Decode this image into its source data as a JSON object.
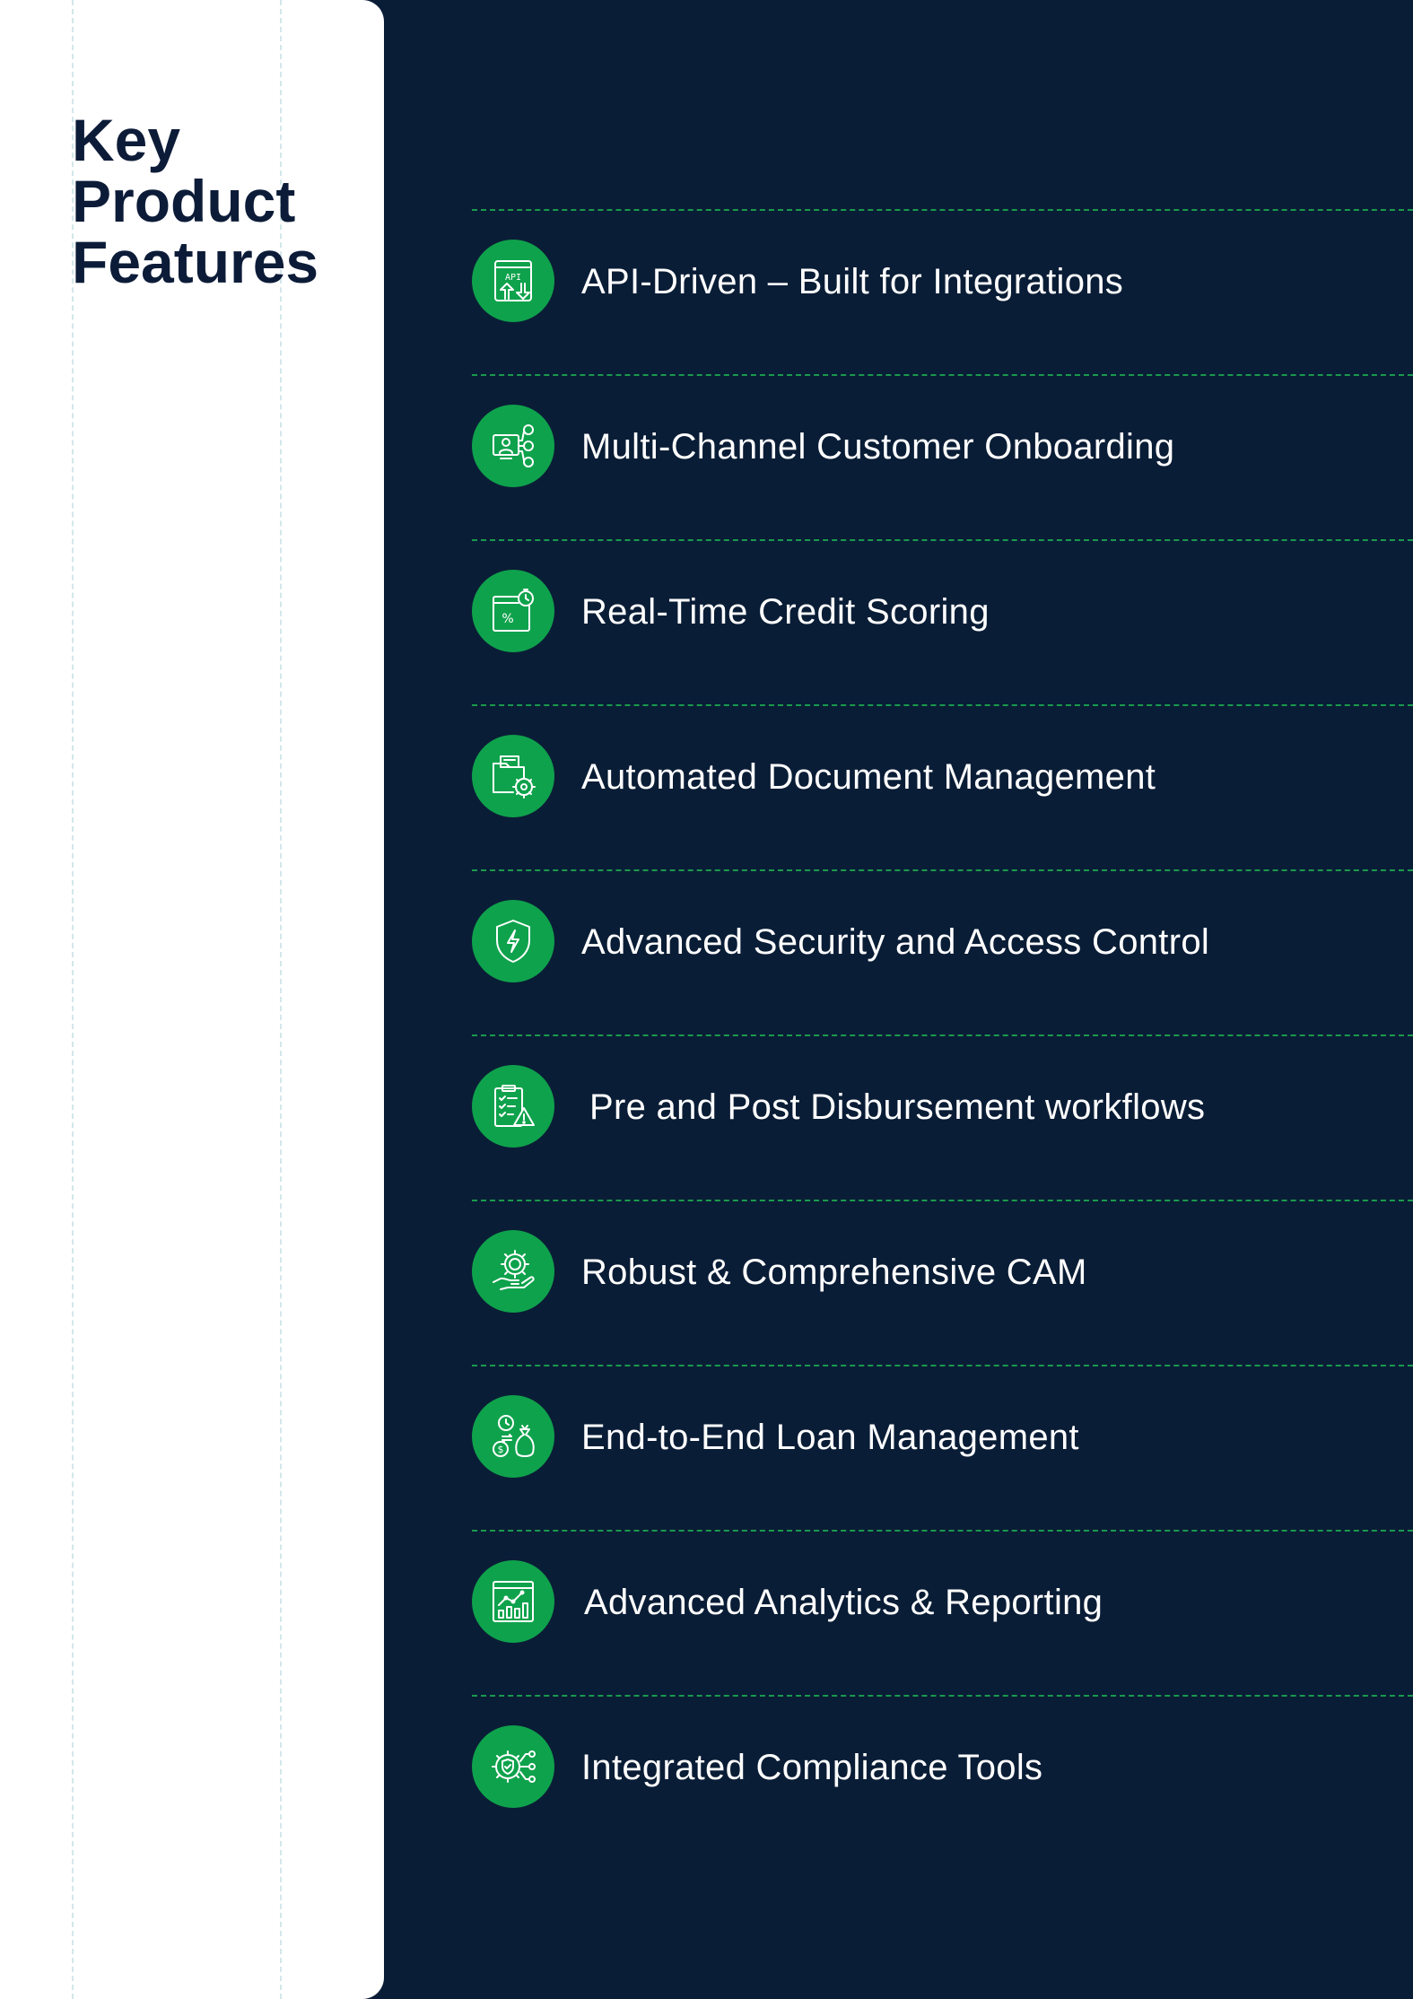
{
  "heading": {
    "line1": "Key",
    "line2": "Product",
    "line3": "Features"
  },
  "colors": {
    "background": "#0a1d36",
    "panel": "#ffffff",
    "heading": "#0c1c38",
    "accent_green": "#0fa24c",
    "divider": "#1a9a4c"
  },
  "features": [
    {
      "label": "API-Driven – Built for Integrations",
      "icon": "api-icon"
    },
    {
      "label": "Multi-Channel Customer Onboarding",
      "icon": "onboarding-icon"
    },
    {
      "label": "Real-Time Credit Scoring",
      "icon": "credit-score-icon"
    },
    {
      "label": "Automated Document Management",
      "icon": "document-gear-icon"
    },
    {
      "label": "Advanced Security and Access Control",
      "icon": "shield-icon"
    },
    {
      "label": "Pre and Post Disbursement workflows",
      "icon": "clipboard-alert-icon"
    },
    {
      "label": "Robust & Comprehensive CAM",
      "icon": "hand-money-icon"
    },
    {
      "label": "End-to-End Loan Management",
      "icon": "loan-bag-icon"
    },
    {
      "label": "Advanced Analytics & Reporting",
      "icon": "analytics-icon"
    },
    {
      "label": "Integrated Compliance Tools",
      "icon": "compliance-gear-icon"
    }
  ]
}
